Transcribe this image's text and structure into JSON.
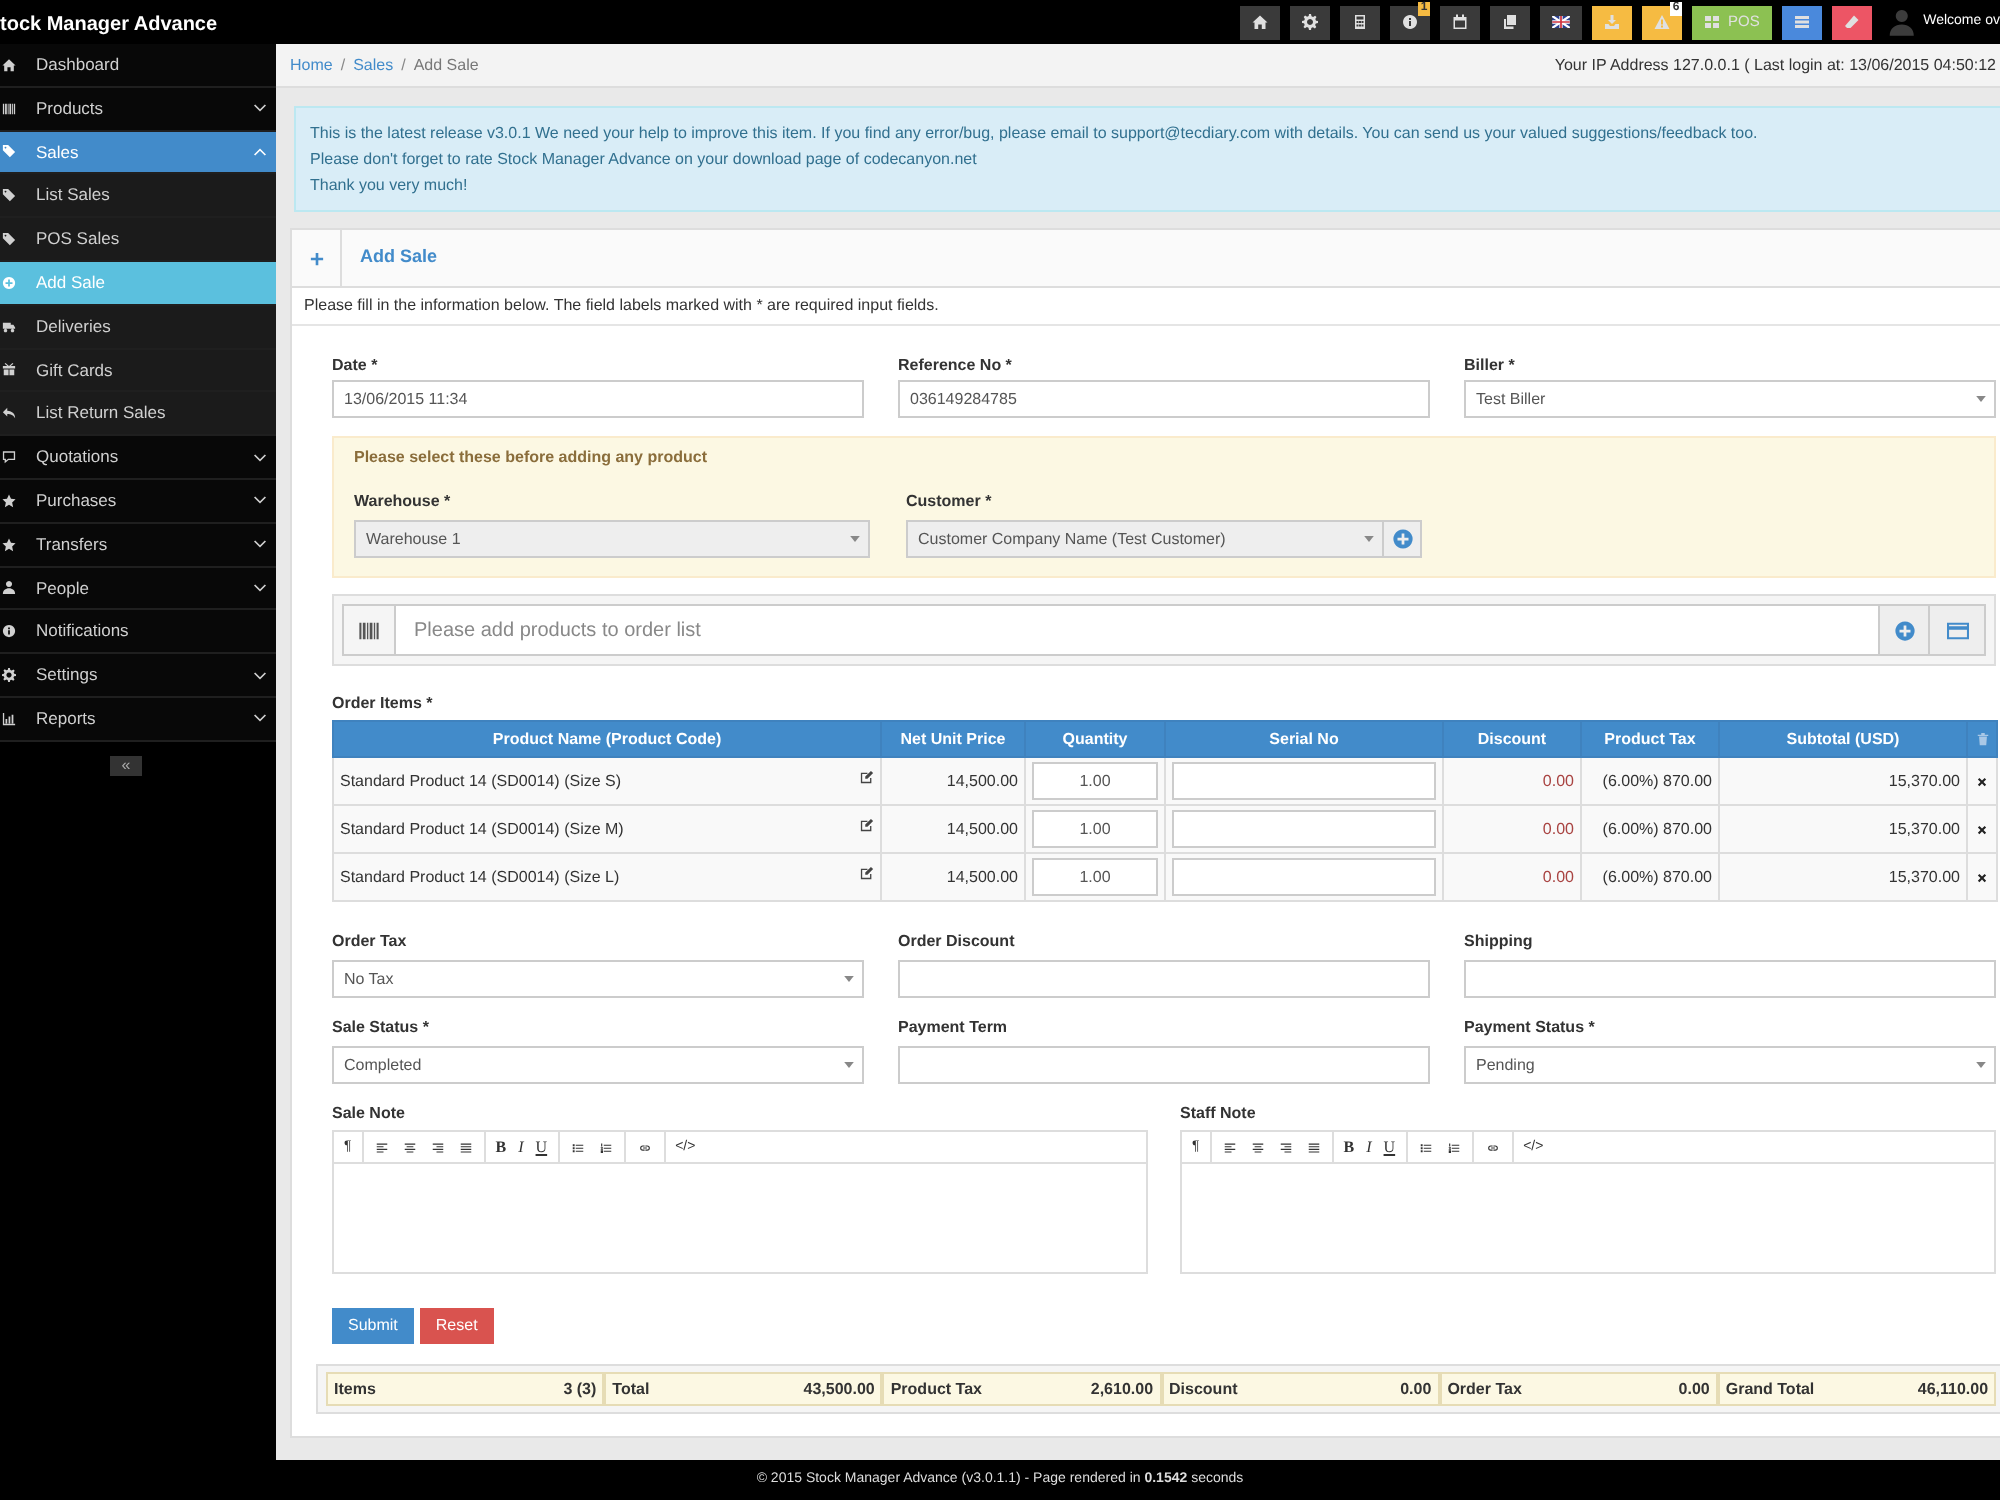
{
  "topbar": {
    "title": "tock Manager Advance",
    "buttons": [
      {
        "color": "#3a3a3a"
      },
      {
        "color": "#3a3a3a"
      },
      {
        "color": "#3a3a3a"
      },
      {
        "color": "#3a3a3a",
        "badge": {
          "text": "1",
          "color": "#f6bb42"
        }
      },
      {
        "color": "#3a3a3a"
      },
      {
        "color": "#3a3a3a"
      },
      {
        "color": "#3a3a3a"
      },
      {
        "color": "#f6bb42"
      },
      {
        "color": "#f6bb42",
        "badge": {
          "text": "6",
          "color": "#ffffff"
        }
      },
      {
        "color": "#8cc152",
        "label": "POS"
      },
      {
        "color": "#4a89dc"
      },
      {
        "color": "#ed5565"
      }
    ],
    "welcome": "Welcome ov"
  },
  "sidebar": {
    "items": [
      {
        "label": "Dashboard",
        "kind": "link",
        "selected": false
      },
      {
        "label": "Products",
        "kind": "group",
        "expanded": false,
        "selected": false
      },
      {
        "label": "Sales",
        "kind": "group",
        "expanded": true,
        "selected": true,
        "children": [
          {
            "label": "List Sales",
            "selected": false
          },
          {
            "label": "POS Sales",
            "selected": false
          },
          {
            "label": "Add Sale",
            "selected": true
          },
          {
            "label": "Deliveries",
            "selected": false
          },
          {
            "label": "Gift Cards",
            "selected": false
          },
          {
            "label": "List Return Sales",
            "selected": false
          }
        ]
      },
      {
        "label": "Quotations",
        "kind": "group",
        "expanded": false,
        "selected": false
      },
      {
        "label": "Purchases",
        "kind": "group",
        "expanded": false,
        "selected": false
      },
      {
        "label": "Transfers",
        "kind": "group",
        "expanded": false,
        "selected": false
      },
      {
        "label": "People",
        "kind": "group",
        "expanded": false,
        "selected": false
      },
      {
        "label": "Notifications",
        "kind": "link",
        "selected": false
      },
      {
        "label": "Settings",
        "kind": "group",
        "expanded": false,
        "selected": false
      },
      {
        "label": "Reports",
        "kind": "group",
        "expanded": false,
        "selected": false
      }
    ],
    "collapse": "«"
  },
  "breadcrumb": {
    "items": [
      "Home",
      "Sales",
      "Add Sale"
    ],
    "separator": "/"
  },
  "ip_info": "Your IP Address 127.0.0.1 ( Last login at: 13/06/2015 04:50:12",
  "alert": [
    "This is the latest release v3.0.1 We need your help to improve this item. If you find any error/bug, please email to support@tecdiary.com with details. You can send us your valued suggestions/feedback too.",
    "Please don't forget to rate Stock Manager Advance on your download page of codecanyon.net",
    "Thank you very much!"
  ],
  "panel": {
    "title": "Add Sale",
    "intro": "Please fill in the information below. The field labels marked with * are required input fields."
  },
  "form": {
    "top_fields": [
      {
        "label": "Date *",
        "kind": "input",
        "value": "13/06/2015 11:34"
      },
      {
        "label": "Reference No *",
        "kind": "input",
        "value": "036149284785"
      },
      {
        "label": "Biller *",
        "kind": "select",
        "value": "Test Biller"
      }
    ],
    "notice": {
      "title": "Please select these before adding any product",
      "fields": [
        {
          "label": "Warehouse *",
          "kind": "select",
          "value": "Warehouse 1",
          "disabled": true
        },
        {
          "label": "Customer *",
          "kind": "select",
          "value": "Customer Company Name (Test Customer)",
          "disabled": true,
          "add_button": true
        }
      ]
    },
    "product_search": {
      "placeholder": "Please add products to order list"
    },
    "order_items": {
      "label": "Order Items *",
      "columns": [
        "Product Name (Product Code)",
        "Net Unit Price",
        "Quantity",
        "Serial No",
        "Discount",
        "Product Tax",
        "Subtotal (USD)"
      ],
      "rows": [
        {
          "product": "Standard Product 14 (SD0014) (Size S)",
          "net_unit_price": "14,500.00",
          "quantity": "1.00",
          "discount": "0.00",
          "product_tax": "(6.00%) 870.00",
          "subtotal": "15,370.00"
        },
        {
          "product": "Standard Product 14 (SD0014) (Size M)",
          "net_unit_price": "14,500.00",
          "quantity": "1.00",
          "discount": "0.00",
          "product_tax": "(6.00%) 870.00",
          "subtotal": "15,370.00"
        },
        {
          "product": "Standard Product 14 (SD0014) (Size L)",
          "net_unit_price": "14,500.00",
          "quantity": "1.00",
          "discount": "0.00",
          "product_tax": "(6.00%) 870.00",
          "subtotal": "15,370.00"
        }
      ]
    },
    "bottom_fields": [
      {
        "label": "Order Tax",
        "kind": "select",
        "value": "No Tax"
      },
      {
        "label": "Order Discount",
        "kind": "input"
      },
      {
        "label": "Shipping",
        "kind": "input"
      },
      {
        "label": "Sale Status *",
        "kind": "select",
        "value": "Completed"
      },
      {
        "label": "Payment Term",
        "kind": "input"
      },
      {
        "label": "Payment Status *",
        "kind": "select",
        "value": "Pending"
      }
    ],
    "notes": [
      {
        "label": "Sale Note",
        "toolbar": [
          {
            "kind": "text",
            "items": [
              "¶"
            ]
          },
          {
            "kind": "align"
          },
          {
            "kind": "format",
            "items": [
              "B",
              "I",
              "U"
            ]
          },
          {
            "kind": "lists"
          },
          {
            "kind": "link"
          },
          {
            "kind": "text",
            "items": [
              "</>"
            ]
          }
        ]
      },
      {
        "label": "Staff Note",
        "toolbar": [
          {
            "kind": "text",
            "items": [
              "¶"
            ]
          },
          {
            "kind": "align"
          },
          {
            "kind": "format",
            "items": [
              "B",
              "I",
              "U"
            ]
          },
          {
            "kind": "lists"
          },
          {
            "kind": "link"
          },
          {
            "kind": "text",
            "items": [
              "</>"
            ]
          }
        ]
      }
    ],
    "buttons": [
      {
        "label": "Submit",
        "kind": "primary"
      },
      {
        "label": "Reset",
        "kind": "danger"
      }
    ],
    "totals": [
      {
        "label": "Items",
        "value": "3 (3)"
      },
      {
        "label": "Total",
        "value": "43,500.00"
      },
      {
        "label": "Product Tax",
        "value": "2,610.00"
      },
      {
        "label": "Discount",
        "value": "0.00"
      },
      {
        "label": "Order Tax",
        "value": "0.00"
      },
      {
        "label": "Grand Total",
        "value": "46,110.00"
      }
    ]
  },
  "footer": "© 2015 Stock Manager Advance (v3.0.1.1) - Page rendered in **0.1542** seconds"
}
